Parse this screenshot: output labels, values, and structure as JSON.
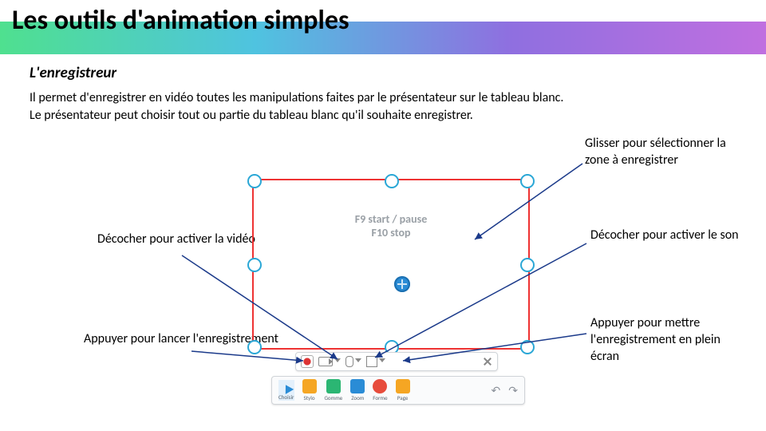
{
  "title": "Les outils d'animation simples",
  "subtitle": "L'enregistreur",
  "description_line1": "Il permet d'enregistrer en vidéo toutes les manipulations faites par le présentateur sur le tableau blanc.",
  "description_line2": "Le présentateur peut choisir tout ou partie du tableau blanc qu'il souhaite enregistrer.",
  "hint_line1": "F9 start / pause",
  "hint_line2": "F10 stop",
  "annotations": {
    "drag": "Glisser pour sélectionner la zone à enregistrer",
    "video": "Décocher pour activer la vidéo",
    "sound": "Décocher pour activer le son",
    "record": "Appuyer pour lancer l'enregistrement",
    "fullscreen": "Appuyer pour mettre l'enregistrement en plein écran"
  },
  "tools": [
    "Choisir",
    "Stylo",
    "Gomme",
    "Zoom",
    "Forme",
    "Page"
  ]
}
